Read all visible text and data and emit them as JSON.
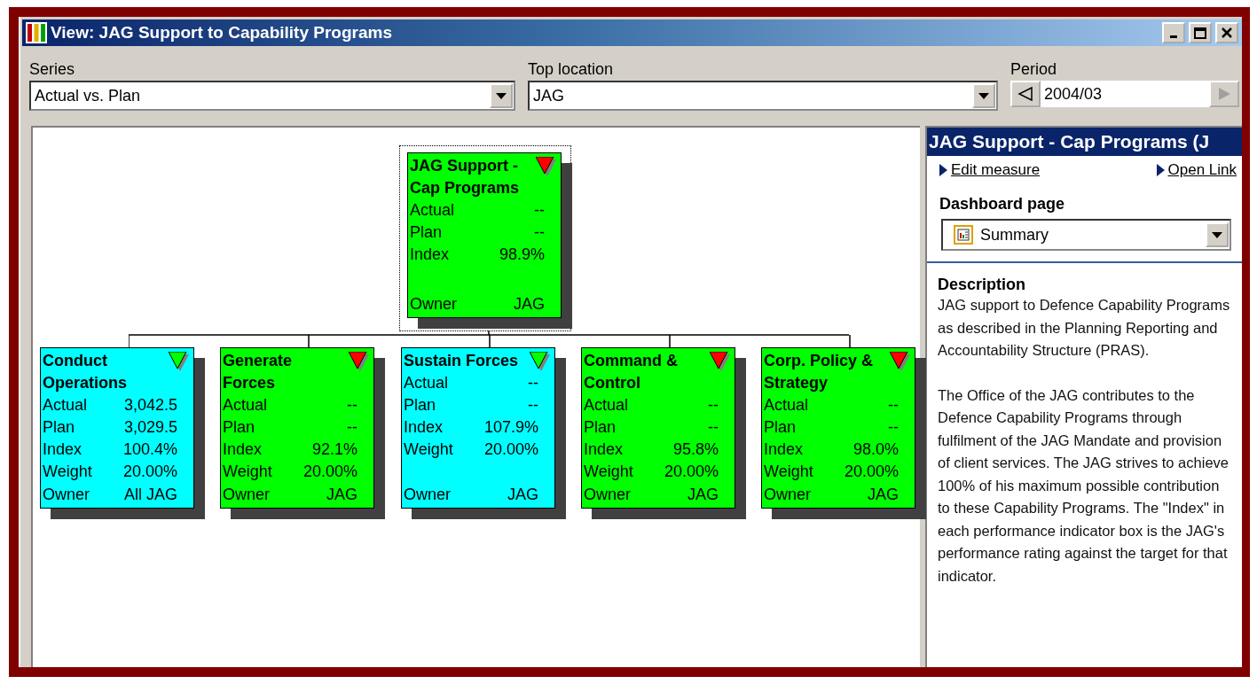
{
  "window": {
    "title": "View: JAG Support to Capability Programs"
  },
  "filters": [
    {
      "kind": "dropdown",
      "label": "Series",
      "value": "Actual vs. Plan"
    },
    {
      "kind": "dropdown",
      "label": "Top location",
      "value": "JAG"
    },
    {
      "kind": "stepper",
      "label": "Period",
      "value": "2004/03",
      "next_disabled": true
    }
  ],
  "root": {
    "title": "JAG Support - Cap Programs",
    "color": "#00ff00",
    "below_target": true,
    "selected": true,
    "rows": [
      {
        "label": "Actual",
        "value": "--"
      },
      {
        "label": "Plan",
        "value": "--"
      },
      {
        "label": "Index",
        "value": "98.9%"
      },
      {
        "label": "Owner",
        "value": "JAG"
      }
    ]
  },
  "children": [
    {
      "title": "Conduct Operations",
      "color": "#00ffff",
      "below_target": false,
      "selected": false,
      "rows": [
        {
          "label": "Actual",
          "value": "3,042.5"
        },
        {
          "label": "Plan",
          "value": "3,029.5"
        },
        {
          "label": "Index",
          "value": "100.4%"
        },
        {
          "label": "Weight",
          "value": "20.00%"
        },
        {
          "label": "Owner",
          "value": "All JAG"
        }
      ]
    },
    {
      "title": "Generate Forces",
      "color": "#00ff00",
      "below_target": true,
      "selected": false,
      "rows": [
        {
          "label": "Actual",
          "value": "--"
        },
        {
          "label": "Plan",
          "value": "--"
        },
        {
          "label": "Index",
          "value": "92.1%"
        },
        {
          "label": "Weight",
          "value": "20.00%"
        },
        {
          "label": "Owner",
          "value": "JAG"
        }
      ]
    },
    {
      "title": "Sustain Forces",
      "color": "#00ffff",
      "below_target": false,
      "selected": false,
      "rows": [
        {
          "label": "Actual",
          "value": "--"
        },
        {
          "label": "Plan",
          "value": "--"
        },
        {
          "label": "Index",
          "value": "107.9%"
        },
        {
          "label": "Weight",
          "value": "20.00%"
        },
        {
          "label": "Owner",
          "value": "JAG"
        }
      ]
    },
    {
      "title": "Command & Control",
      "color": "#00ff00",
      "below_target": true,
      "selected": false,
      "rows": [
        {
          "label": "Actual",
          "value": "--"
        },
        {
          "label": "Plan",
          "value": "--"
        },
        {
          "label": "Index",
          "value": "95.8%"
        },
        {
          "label": "Weight",
          "value": "20.00%"
        },
        {
          "label": "Owner",
          "value": "JAG"
        }
      ]
    },
    {
      "title": "Corp. Policy & Strategy",
      "color": "#00ff00",
      "below_target": true,
      "selected": false,
      "rows": [
        {
          "label": "Actual",
          "value": "--"
        },
        {
          "label": "Plan",
          "value": "--"
        },
        {
          "label": "Index",
          "value": "98.0%"
        },
        {
          "label": "Weight",
          "value": "20.00%"
        },
        {
          "label": "Owner",
          "value": "JAG"
        }
      ]
    }
  ],
  "panel": {
    "header": "JAG Support - Cap Programs (J",
    "links": [
      "Edit measure",
      "Open Link"
    ],
    "dashboard_label": "Dashboard page",
    "dashboard_value": "Summary",
    "description_heading": "Description",
    "paragraphs": [
      "JAG support to Defence Capability Programs as described in the Planning Reporting and Accountability Structure (PRAS).",
      "The Office of the JAG contributes to the Defence Capability Programs through fulfilment of the JAG Mandate and provision of client services.  The JAG strives to achieve 100% of his maximum possible contribution to these Capability Programs.  The \"Index\" in each performance indicator box is the JAG's performance rating against the target for that indicator."
    ]
  }
}
